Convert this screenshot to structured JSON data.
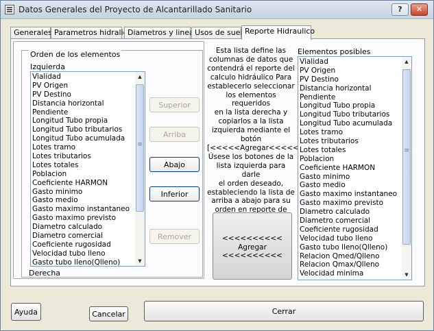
{
  "window": {
    "title": "Datos Generales del Proyecto de Alcantarillado Sanitario",
    "help_label": "?",
    "close_label": "✕"
  },
  "tabs": [
    {
      "label": "Generales"
    },
    {
      "label": "Parametros hidralica"
    },
    {
      "label": "Diametros y lineas"
    },
    {
      "label": "Usos de suelo"
    },
    {
      "label": "Reporte Hidraulico"
    }
  ],
  "order_group": {
    "title": "Orden de los elementos",
    "left_label": "Izquierda",
    "right_label": "Derecha"
  },
  "left_list": {
    "items": [
      "Vialidad",
      "PV Origen",
      "PV Destino",
      "Distancia horizontal",
      "Pendiente",
      "Longitud Tubo propia",
      "Longitud Tubo tributarios",
      "Longitud Tubo acumulada",
      "Lotes tramo",
      "Lotes tributarios",
      "Lotes totales",
      "Poblacion",
      "Coeficiente HARMON",
      "Gasto minimo",
      "Gasto medio",
      "Gasto maximo instantaneo",
      "Gasto maximo previsto",
      "Diametro calculado",
      "Diametro comercial",
      "Coeficiente rugosidad",
      "Velocidad tubo lleno",
      "Gasto tubo lleno(Qlleno)"
    ]
  },
  "order_buttons": {
    "superior": "Superior",
    "arriba": "Arriba",
    "abajo": "Abajo",
    "inferior": "Inferior",
    "remover": "Remover"
  },
  "description": "Esta lista define las\ncolumnas de datos que\ncontendrá el reporte del\ncalculo hidráulico Para\nestablecerlo seleccionar\nlos elementos requeridos\nen la lista derecha y\ncopiarlos a la lista\nizquierda mediante el\nbotón\n[<<<<<Agregar<<<<<]\nÚsese los botones de la\nlista izquierda para darle\nel orden deseado,\nestableciendo la lista de\narriba a abajo para su\norden en reporte de\nizquierda a derecha.",
  "agregar_button": "<<<<<<<<<<\nAgregar\n<<<<<<<<<<",
  "right_list": {
    "label": "Elementos posibles",
    "items": [
      "Vialidad",
      "PV Origen",
      "PV Destino",
      "Distancia horizontal",
      "Pendiente",
      "Longitud Tubo propia",
      "Longitud Tubo tributarios",
      "Longitud Tubo acumulada",
      "Lotes tramo",
      "Lotes tributarios",
      "Lotes totales",
      "Poblacion",
      "Coeficiente HARMON",
      "Gasto minimo",
      "Gasto medio",
      "Gasto maximo instantaneo",
      "Gasto maximo previsto",
      "Diametro calculado",
      "Diametro comercial",
      "Coeficiente rugosidad",
      "Velocidad tubo lleno",
      "Gasto tubo lleno(Qlleno)",
      "Relacion Qmed/Qlleno",
      "Relacion Qmax/Qlleno",
      "Velocidad minima"
    ]
  },
  "footer": {
    "ayuda": "Ayuda",
    "cancelar": "Cancelar",
    "cerrar": "Cerrar"
  }
}
